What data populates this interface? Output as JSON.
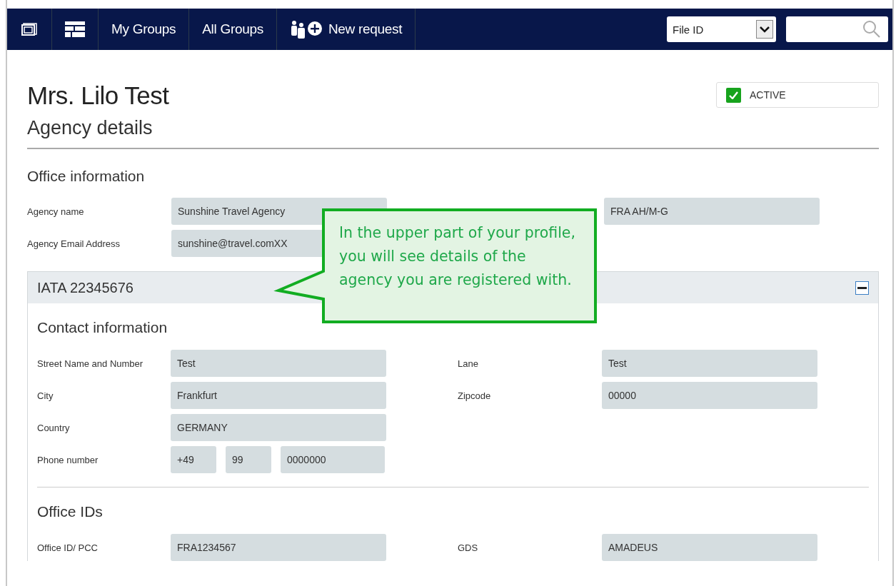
{
  "nav": {
    "links": [
      "My Groups",
      "All Groups"
    ],
    "new_request": "New request",
    "search_type": "File ID"
  },
  "title": "Mrs. Lilo Test",
  "status": {
    "label": "ACTIVE",
    "checked": true
  },
  "heading": "Agency details",
  "office_information": {
    "title": "Office information",
    "rows": [
      {
        "label": "Agency name",
        "value": "Sunshine Travel Agency",
        "column_3_value": "FRA AH/M-G"
      },
      {
        "label": "Agency Email Address",
        "value": "sunshine@travel.comXX"
      }
    ]
  },
  "panel": {
    "title": "IATA 22345676",
    "expanded": true,
    "contact": {
      "title": "Contact information",
      "rows": [
        {
          "label": "Street Name and Number",
          "value": "Test",
          "right_label": "Lane",
          "right_value": "Test"
        },
        {
          "label": "City",
          "value": "Frankfurt",
          "right_label": "Zipcode",
          "right_value": "00000"
        },
        {
          "label": "Country",
          "value": "GERMANY"
        }
      ],
      "phone": {
        "label": "Phone number",
        "parts": [
          "+49",
          "99",
          "0000000"
        ]
      }
    },
    "office_ids": {
      "title": "Office IDs",
      "rows": [
        {
          "label": "Office ID/ PCC",
          "value": "FRA1234567",
          "right_label": "GDS",
          "right_value": "AMADEUS"
        }
      ]
    }
  },
  "callout": "In the upper part of your profile, you will see details of the agency you are registered with."
}
